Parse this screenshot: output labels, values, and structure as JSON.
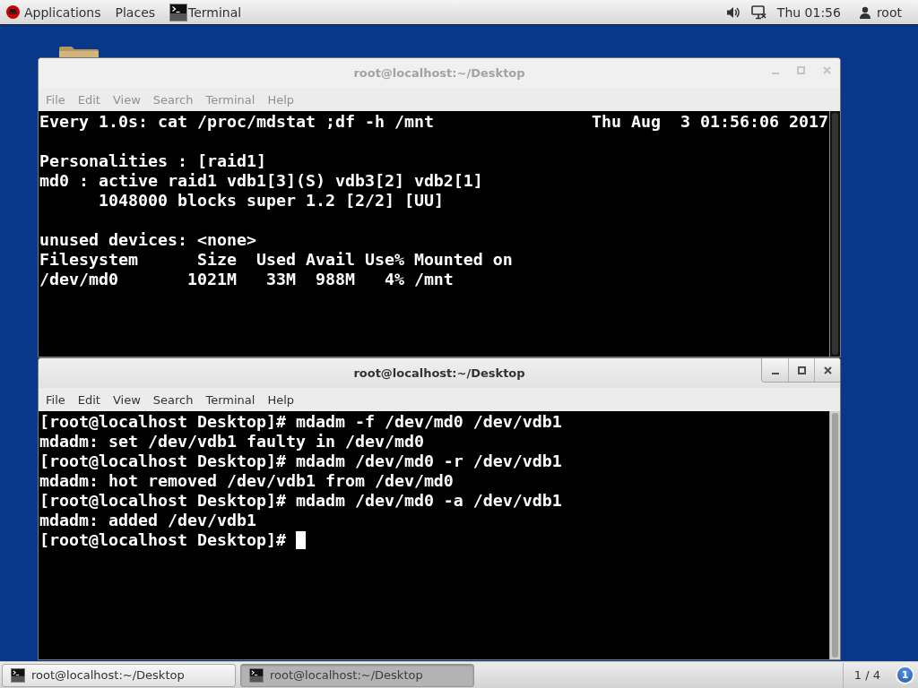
{
  "top_bar": {
    "applications_menu": "Applications",
    "places_menu": "Places",
    "app_menu": "Terminal",
    "clock": "Thu 01:56",
    "user_menu": "root"
  },
  "windows": [
    {
      "title": "root@localhost:~/Desktop",
      "active": false,
      "menu": [
        "File",
        "Edit",
        "View",
        "Search",
        "Terminal",
        "Help"
      ],
      "terminal": {
        "header": {
          "command": "Every 1.0s: cat /proc/mdstat ;df -h /mnt",
          "time": "Thu Aug  3 01:56:06 2017"
        },
        "blocks": [
          [
            "Personalities : [raid1]",
            "md0 : active raid1 vdb1[3](S) vdb3[2] vdb2[1]",
            "      1048000 blocks super 1.2 [2/2] [UU]"
          ],
          [
            "unused devices: <none>",
            "Filesystem      Size  Used Avail Use% Mounted on",
            "/dev/md0       1021M   33M  988M   4% /mnt"
          ]
        ]
      }
    },
    {
      "title": "root@localhost:~/Desktop",
      "active": true,
      "menu": [
        "File",
        "Edit",
        "View",
        "Search",
        "Terminal",
        "Help"
      ],
      "terminal": {
        "blocks": [
          [
            "[root@localhost Desktop]# mdadm -f /dev/md0 /dev/vdb1",
            "mdadm: set /dev/vdb1 faulty in /dev/md0",
            "[root@localhost Desktop]# mdadm /dev/md0 -r /dev/vdb1",
            "mdadm: hot removed /dev/vdb1 from /dev/md0",
            "[root@localhost Desktop]# mdadm /dev/md0 -a /dev/vdb1",
            "mdadm: added /dev/vdb1",
            "[root@localhost Desktop]#"
          ]
        ],
        "cursor": true
      }
    }
  ],
  "taskbar": {
    "items": [
      {
        "label": "root@localhost:~/Desktop",
        "selected": false
      },
      {
        "label": "root@localhost:~/Desktop",
        "selected": true
      }
    ],
    "workspace": "1 / 4",
    "notification_count": "1"
  }
}
